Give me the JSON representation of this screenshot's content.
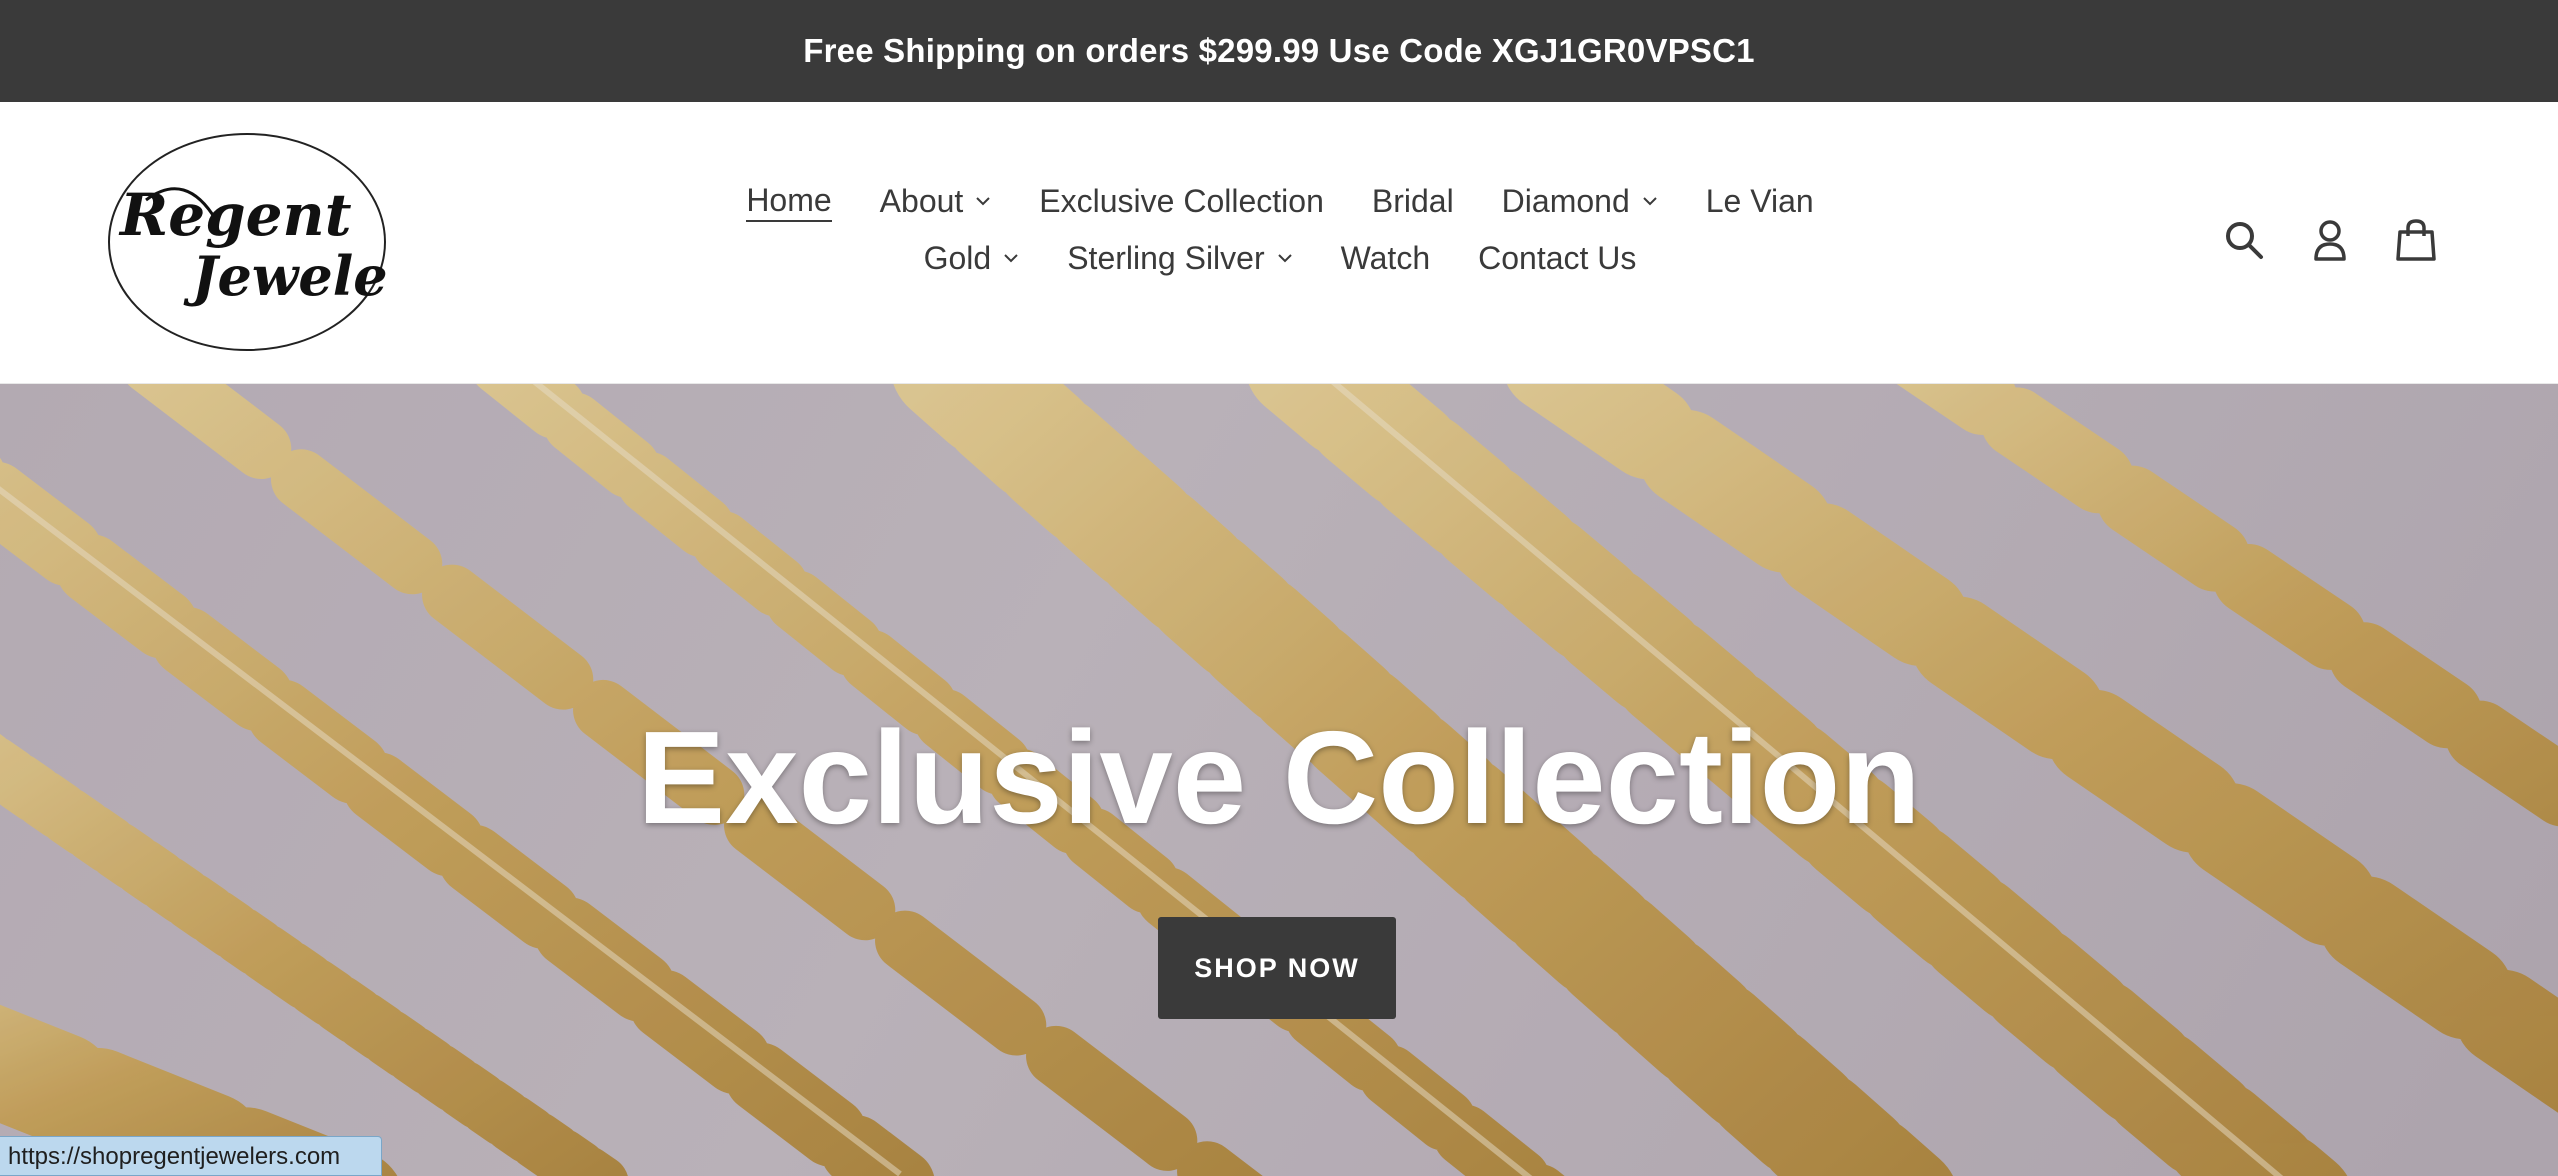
{
  "announcement": {
    "text": "Free Shipping on orders $299.99 Use Code XGJ1GR0VPSC1"
  },
  "logo": {
    "name": "Regent Jewelers",
    "line1": "Regent",
    "line2": "Jewelers"
  },
  "nav": {
    "row1": [
      {
        "label": "Home",
        "active": true,
        "dropdown": false
      },
      {
        "label": "About",
        "active": false,
        "dropdown": true
      },
      {
        "label": "Exclusive Collection",
        "active": false,
        "dropdown": false
      },
      {
        "label": "Bridal",
        "active": false,
        "dropdown": false
      },
      {
        "label": "Diamond",
        "active": false,
        "dropdown": true
      },
      {
        "label": "Le Vian",
        "active": false,
        "dropdown": false
      }
    ],
    "row2": [
      {
        "label": "Gold",
        "active": false,
        "dropdown": true
      },
      {
        "label": "Sterling Silver",
        "active": false,
        "dropdown": true
      },
      {
        "label": "Watch",
        "active": false,
        "dropdown": false
      },
      {
        "label": "Contact Us",
        "active": false,
        "dropdown": false
      }
    ]
  },
  "header_icons": [
    "search-icon",
    "account-icon",
    "cart-icon"
  ],
  "hero": {
    "title": "Exclusive Collection",
    "button_label": "SHOP NOW"
  },
  "status_bar": {
    "url": "https://shopregentjewelers.com"
  },
  "colors": {
    "announcement_bg": "#3a3a3a",
    "button_bg": "#3a3a3a",
    "text": "#3a3a3a",
    "hero_bg": "#c4bcc3",
    "gold": "#d9b867"
  }
}
